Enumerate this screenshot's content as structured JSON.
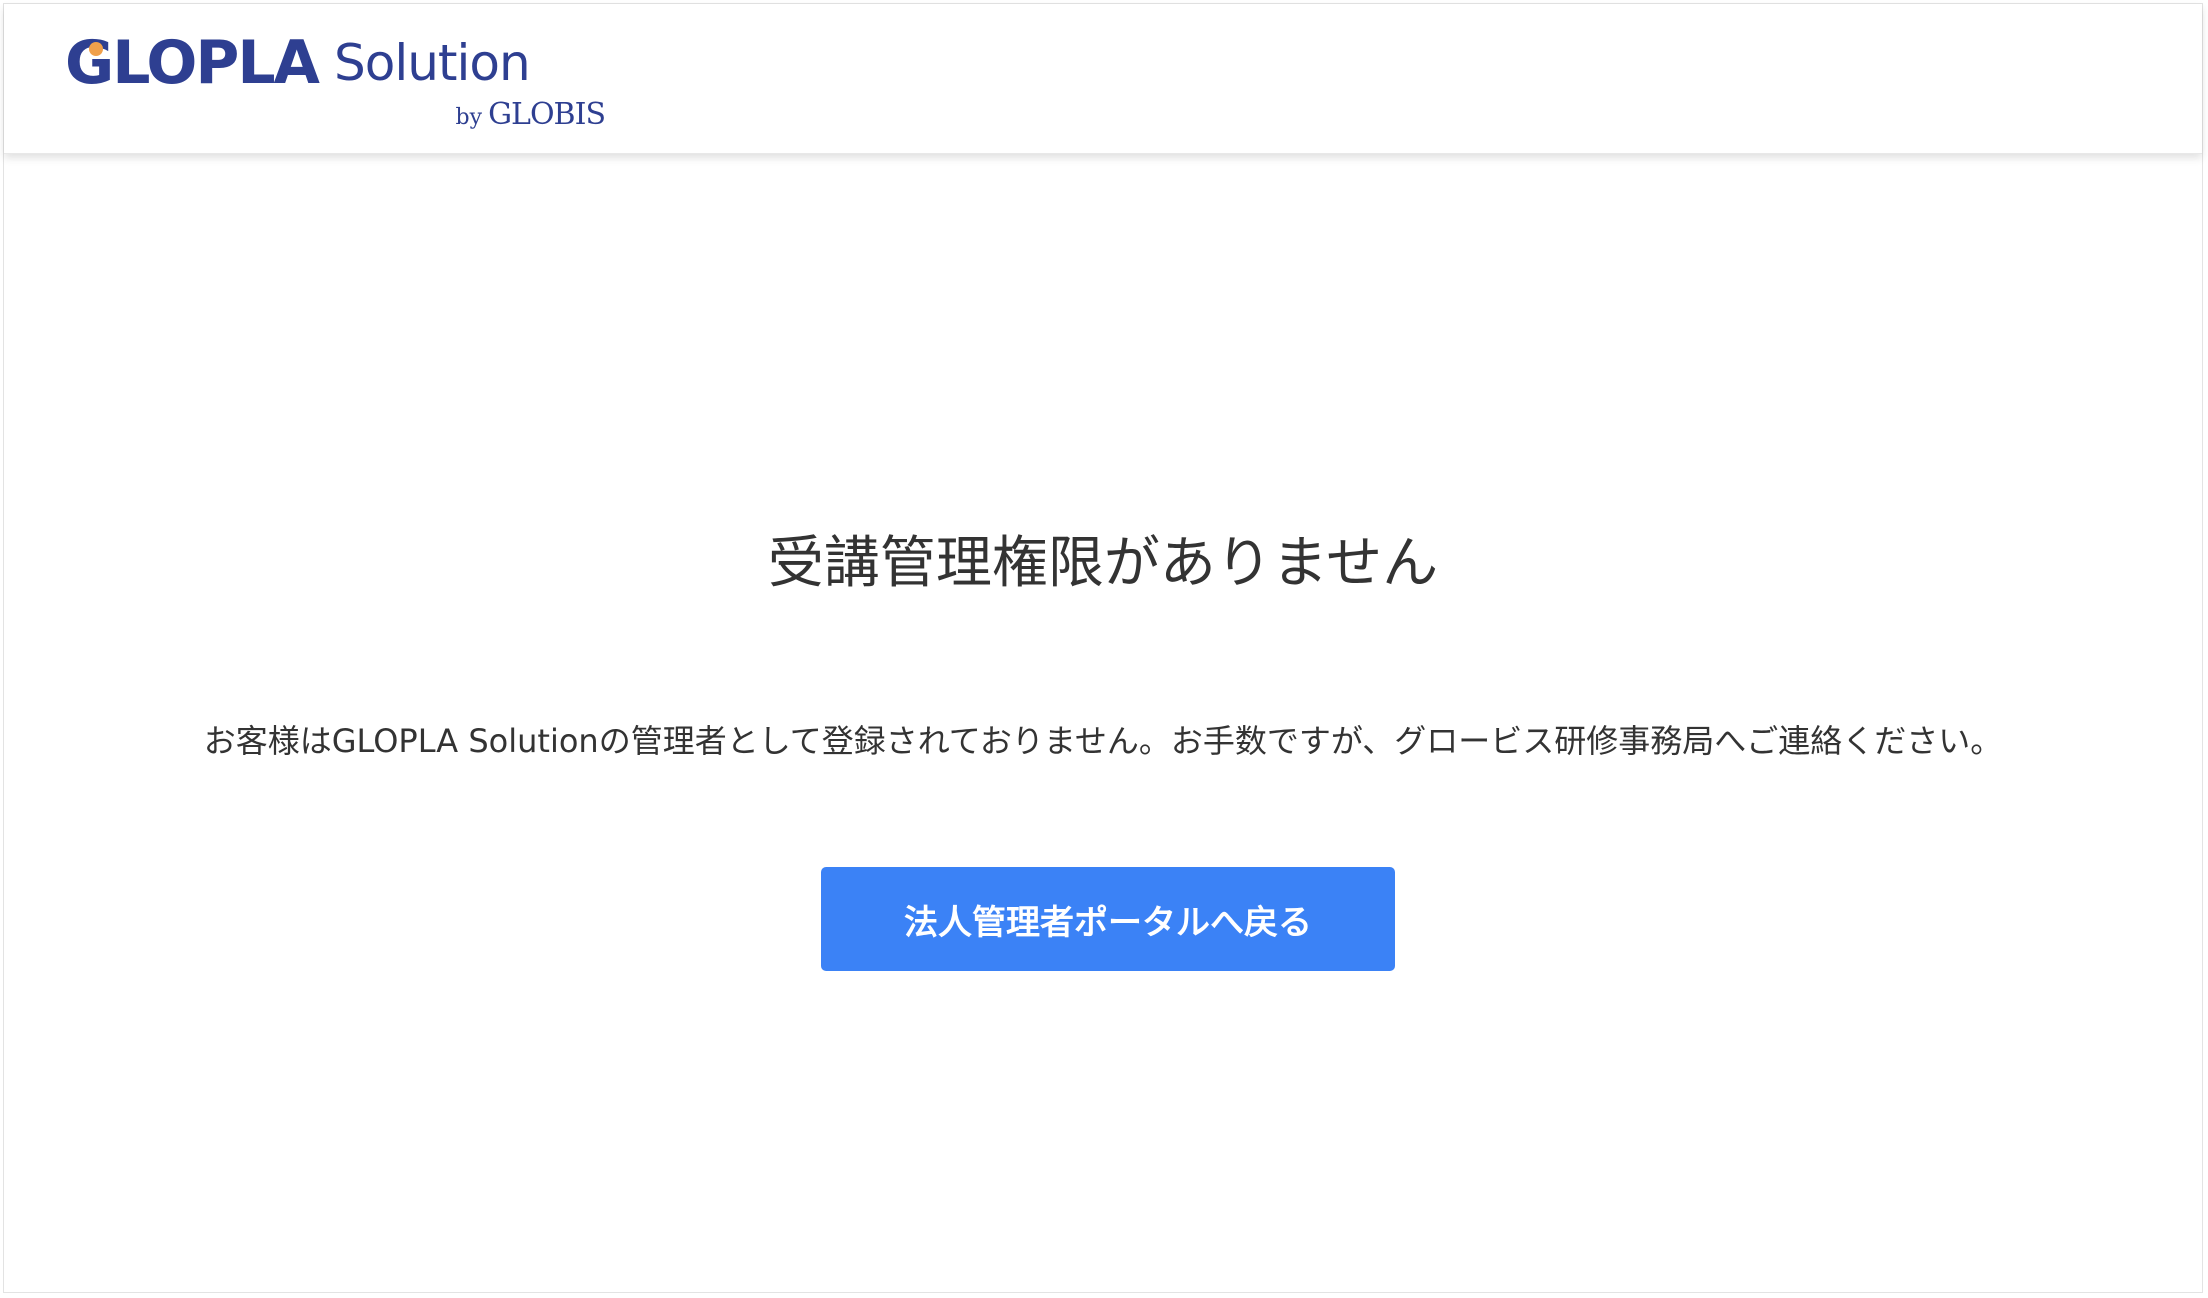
{
  "header": {
    "logo": {
      "brand": "GLOPLA",
      "product": "Solution",
      "by_prefix": "by",
      "by_company": "GLOBIS"
    }
  },
  "main": {
    "title": "受講管理権限がありません",
    "message": "お客様はGLOPLA Solutionの管理者として登録されておりません。お手数ですが、グロービス研修事務局へご連絡ください。",
    "back_button_label": "法人管理者ポータルへ戻る"
  },
  "colors": {
    "brand_navy": "#2e3f91",
    "brand_orange_dot": "#f0a04b",
    "button_blue": "#3b82f6",
    "text_dark": "#333333"
  }
}
